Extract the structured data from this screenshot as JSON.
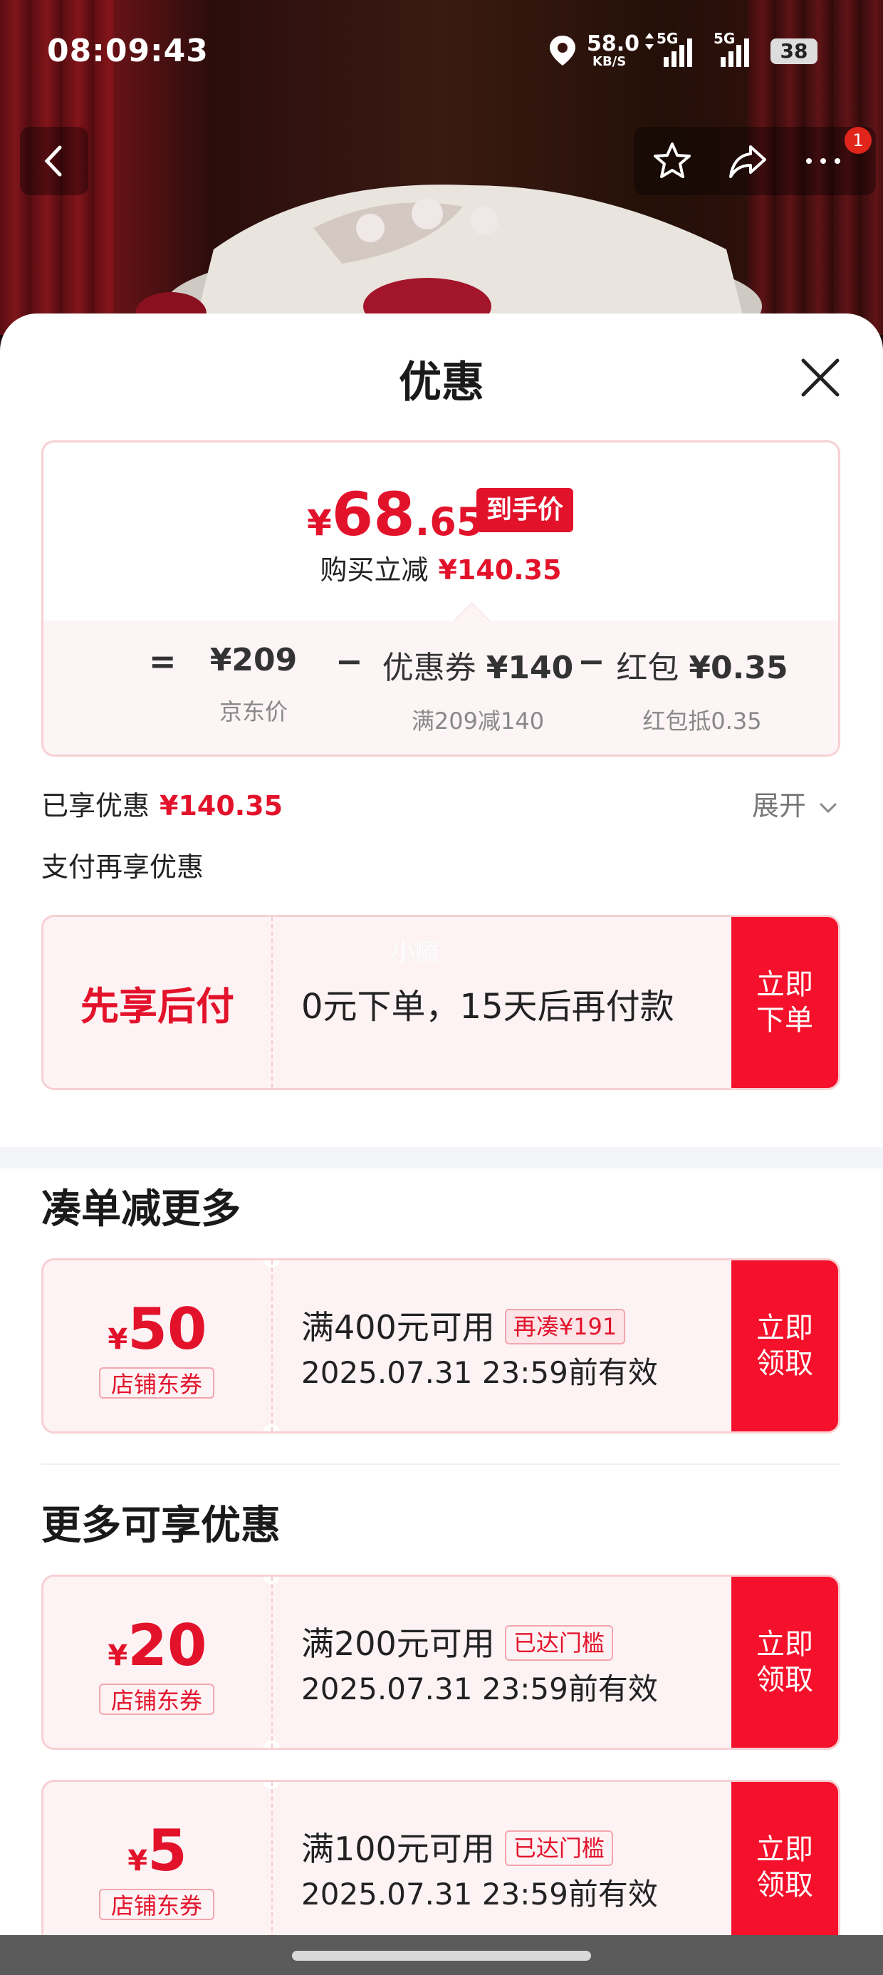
{
  "status_bar": {
    "time": "08:09:43",
    "net_speed": "58.0",
    "net_unit": "KB/S",
    "sim1": "5G",
    "sim2": "5G",
    "battery": "38"
  },
  "nav": {
    "badge_count": "1"
  },
  "sheet": {
    "title": "优惠",
    "final_price": {
      "currency": "¥",
      "integer": "68",
      "decimal": ".65",
      "tag": "到手价"
    },
    "reduce_label": "购买立减",
    "reduce_amount": "¥140.35",
    "breakdown": {
      "eq": "=",
      "minus": "−",
      "items": [
        {
          "main_label": "",
          "main_value": "¥209",
          "sub": "京东价"
        },
        {
          "main_label": "优惠券",
          "main_value": "¥140",
          "sub": "满209减140"
        },
        {
          "main_label": "红包",
          "main_value": "¥0.35",
          "sub": "红包抵0.35"
        }
      ]
    },
    "enjoyed_label": "已享优惠",
    "enjoyed_amount": "¥140.35",
    "expand_label": "展开",
    "pay_more_label": "支付再享优惠",
    "pay_later": {
      "title": "先享后付",
      "desc": "0元下单，15天后再付款",
      "cta": "立即\n下单",
      "watermark": "小瘾"
    },
    "section_combine": "凑单减更多",
    "section_more": "更多可享优惠",
    "coupons": [
      {
        "currency": "¥",
        "amount": "50",
        "type": "店铺东券",
        "condition": "满400元可用",
        "badge": "再凑¥191",
        "valid": "2025.07.31 23:59前有效",
        "cta": "立即\n领取"
      },
      {
        "currency": "¥",
        "amount": "20",
        "type": "店铺东券",
        "condition": "满200元可用",
        "badge": "已达门槛",
        "valid": "2025.07.31 23:59前有效",
        "cta": "立即\n领取"
      },
      {
        "currency": "¥",
        "amount": "5",
        "type": "店铺东券",
        "condition": "满100元可用",
        "badge": "已达门槛",
        "valid": "2025.07.31 23:59前有效",
        "cta": "立即\n领取"
      }
    ]
  },
  "colors": {
    "accent_red": "#e3122b",
    "cta_red": "#f5112b",
    "coupon_bg": "#fef3f4",
    "border": "#f7d0d3"
  }
}
